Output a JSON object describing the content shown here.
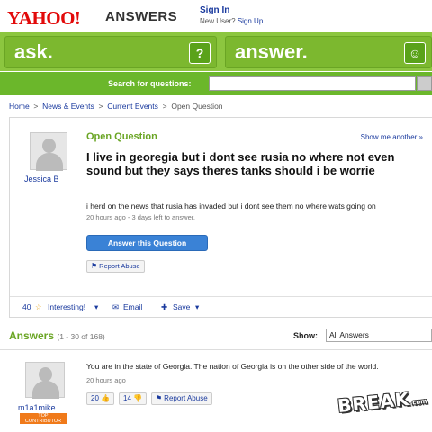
{
  "header": {
    "logo": "YAHOO!",
    "logo_sub": "ANSWERS",
    "signin": "Sign In",
    "newuser": "New User?",
    "signup": "Sign Up"
  },
  "banner": {
    "ask": "ask.",
    "ask_badge": "?",
    "answer": "answer.",
    "answer_badge": "☺"
  },
  "search": {
    "label": "Search for questions:",
    "value": ""
  },
  "breadcrumb": {
    "home": "Home",
    "news": "News & Events",
    "current": "Current Events",
    "page": "Open Question"
  },
  "question": {
    "status": "Open Question",
    "show_another": "Show me another »",
    "asker": "Jessica B",
    "title": "I live in georegia but i dont see rusia no where not even sound but they says theres tanks should i be worrie",
    "detail": "i herd on the news that rusia has invaded but i dont see them no where wats going on",
    "meta": "20 hours ago - 3 days left to answer.",
    "answer_button": "Answer this Question",
    "report": "Report Abuse",
    "interesting_count": "40",
    "interesting": "Interesting!",
    "email": "Email",
    "save": "Save"
  },
  "answers": {
    "title": "Answers",
    "count": "(1 - 30 of 168)",
    "show_label": "Show:",
    "show_value": "All Answers",
    "items": [
      {
        "author": "m1a1mike...",
        "badge_line1": "TOP",
        "badge_line2": "CONTRIBUTOR",
        "text": "You are in the state of Georgia. The nation of Georgia is on the other side of the world.",
        "meta": "20 hours ago",
        "up": "20",
        "down": "14",
        "report": "Report Abuse"
      }
    ]
  },
  "watermark": {
    "text": "BREAK",
    "suffix": ".com"
  },
  "colors": {
    "brand_red": "#e20a0a",
    "green": "#8cc63f",
    "link_blue": "#1a3a9e",
    "button_blue": "#3a82d6"
  }
}
